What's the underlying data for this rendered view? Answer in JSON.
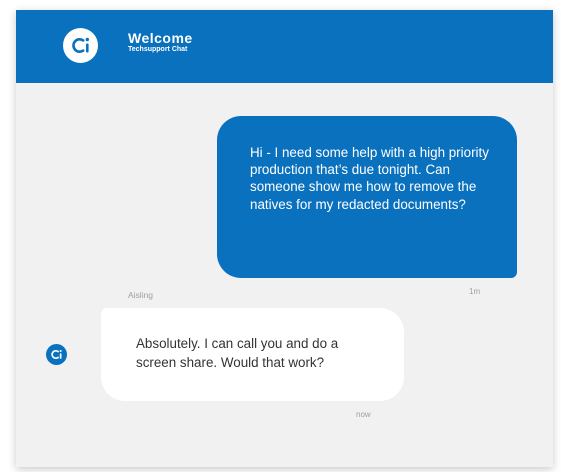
{
  "colors": {
    "brand_blue": "#0a71bf",
    "chat_background": "#f1f1f1",
    "incoming_bubble": "#ffffff",
    "meta_text": "#9e9e9e"
  },
  "header": {
    "logo_icon": "ci-logo-icon",
    "title": "Welcome",
    "subtitle": "Techsupport Chat"
  },
  "messages": [
    {
      "direction": "outgoing",
      "text": "Hi - I need some help with a high priority production that’s due tonight. Can someone show me how to remove the natives for my redacted documents?",
      "time": "1m"
    },
    {
      "direction": "incoming",
      "sender": "Aisling",
      "avatar_icon": "ci-avatar-icon",
      "text": "Absolutely. I can call you and do a screen share. Would that work?",
      "time": "now"
    }
  ]
}
